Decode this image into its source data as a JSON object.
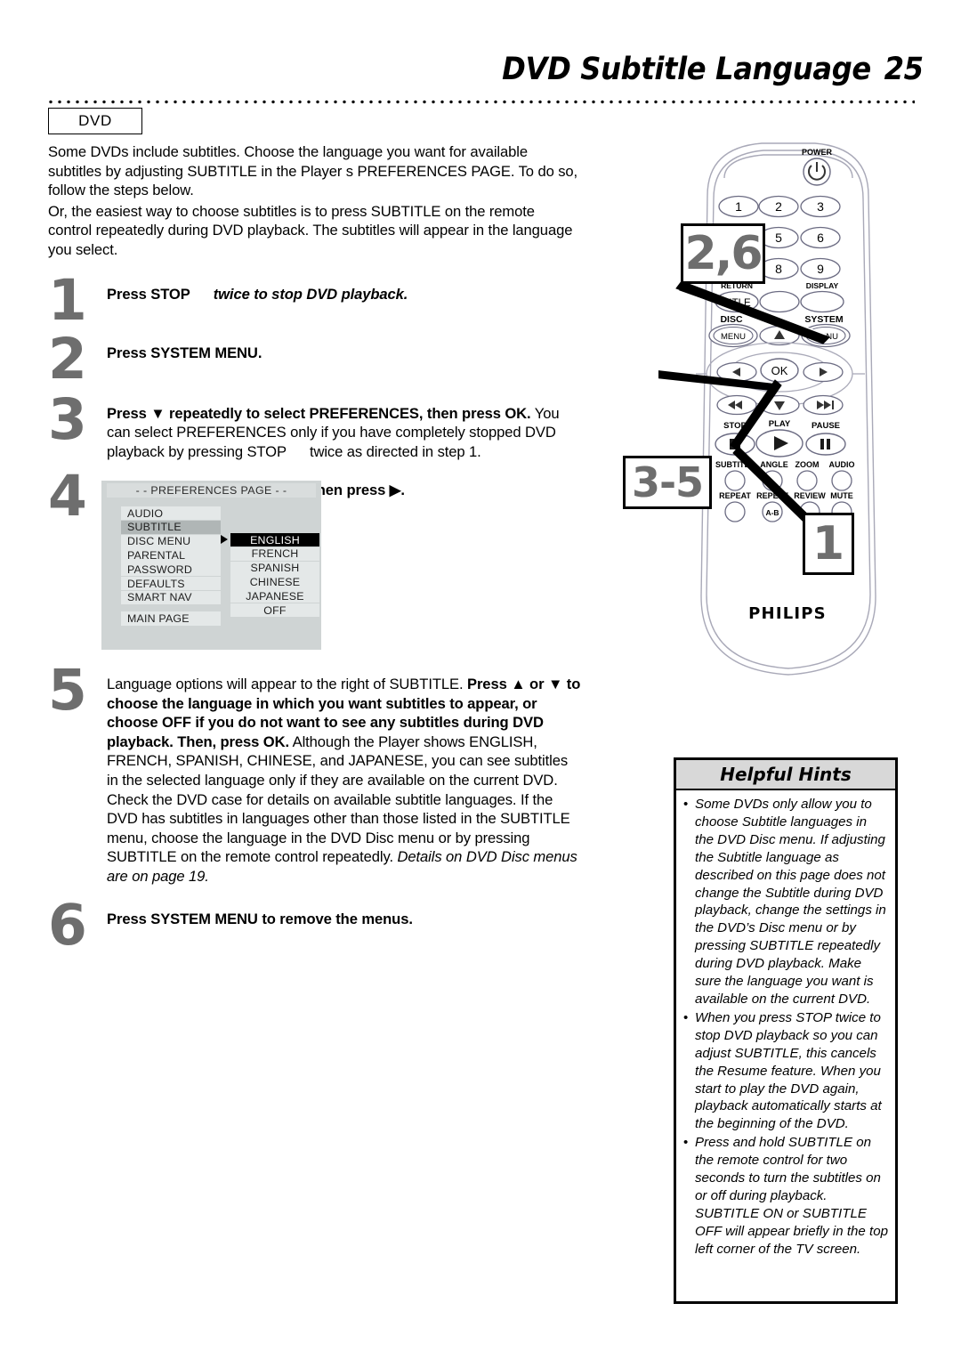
{
  "header": {
    "title": "DVD Subtitle Language",
    "page_number": "25",
    "badge": "DVD"
  },
  "intro": {
    "p1": "Some DVDs include subtitles. Choose the language you want for available subtitles by adjusting SUBTITLE in the Player s PREFERENCES PAGE. To do so, follow the steps below.",
    "p2": "Or, the easiest way to choose subtitles is to press SUBTITLE on the remote control repeatedly during DVD playback. The subtitles will appear in the language you select."
  },
  "steps": {
    "s1": {
      "num": "1",
      "lead_b": "Press STOP",
      "lead_i": "twice to stop DVD playback."
    },
    "s2": {
      "num": "2",
      "text": "Press SYSTEM MENU."
    },
    "s3": {
      "num": "3",
      "bold1": "Press ▼ repeatedly to select PREFERENCES, then press OK.",
      "rest": "You can select PREFERENCES only if you have completely stopped DVD playback by pressing STOP",
      "rest2": "twice as directed in step 1."
    },
    "s4": {
      "num": "4",
      "text": "Press ▼ to select SUBTITLE, then press ▶."
    },
    "s5": {
      "num": "5",
      "normal1": "Language options will appear to the right of SUBTITLE.",
      "bold1": "Press ▲ or ▼ to choose the language in which you want subtitles to appear, or choose OFF if you do not want to see any subtitles during DVD playback. Then, press OK.",
      "normal2": "Although the Player shows ENGLISH, FRENCH, SPANISH, CHINESE, and JAPANESE, you can see subtitles in the selected language only if they are available on the current DVD. Check the DVD case for details on available subtitle languages.",
      "normal3": "If the DVD has subtitles in languages other than those listed in the SUBTITLE menu, choose the language in the DVD Disc menu or by pressing SUBTITLE on the remote control repeatedly.",
      "italic1": "Details on DVD Disc menus are on page 19."
    },
    "s6": {
      "num": "6",
      "text": "Press SYSTEM MENU to remove the menus."
    }
  },
  "osd": {
    "title": "- -  PREFERENCES PAGE  - -",
    "left_items": [
      "AUDIO",
      "SUBTITLE",
      "DISC MENU",
      "PARENTAL",
      "PASSWORD",
      "DEFAULTS",
      "SMART NAV"
    ],
    "selected_left": "SUBTITLE",
    "main_page": "MAIN PAGE",
    "right_items": [
      "ENGLISH",
      "FRENCH",
      "SPANISH",
      "CHINESE",
      "JAPANESE",
      "OFF"
    ],
    "selected_right": "ENGLISH"
  },
  "remote": {
    "brand": "PHILIPS",
    "power_label": "POWER",
    "keys": [
      "1",
      "2",
      "3",
      "5",
      "6",
      "8",
      "9"
    ],
    "return_label": "RETURN",
    "title_label": "TITLE",
    "display_label": "DISPLAY",
    "disc_label": "DISC",
    "disc_menu_label": "MENU",
    "system_label": "SYSTEM",
    "system_menu_label": "MENU",
    "ok_label": "OK",
    "stop_label": "STOP",
    "play_label": "PLAY",
    "pause_label": "PAUSE",
    "subtitle_label": "SUBTITLE",
    "angle_label": "ANGLE",
    "zoom_label": "ZOOM",
    "audio_label": "AUDIO",
    "repeat_label": "REPEAT",
    "repeat_ab_label": "REPEAT",
    "ab_label": "A-B",
    "review_label": "REVIEW",
    "mute_label": "MUTE",
    "callouts": {
      "c26": "2,6",
      "c35": "3-5",
      "c1": "1"
    }
  },
  "hints": {
    "title": "Helpful Hints",
    "bullet": "•",
    "items": [
      "Some DVDs only allow you to choose Subtitle languages in the DVD Disc menu. If adjusting the Subtitle language as described on this page does not change the Subtitle during DVD playback, change the settings in the DVD’s Disc menu or by pressing SUBTITLE repeatedly during DVD playback. Make sure the language you want is available on the current DVD.",
      "When you press STOP twice to stop DVD playback so you can adjust SUBTITLE, this cancels the Resume feature. When you start to play the DVD again, playback automatically starts at the beginning of the DVD.",
      "Press and hold SUBTITLE on the remote control for two seconds to turn the subtitles on or off during playback. SUBTITLE ON or SUBTITLE OFF will appear briefly in the top left corner of the TV screen."
    ]
  }
}
